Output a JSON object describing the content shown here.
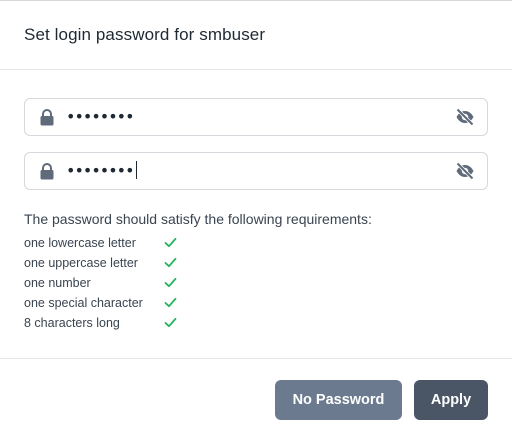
{
  "dialog": {
    "title": "Set login password for smbuser"
  },
  "fields": [
    {
      "name": "password",
      "value": "••••••••",
      "icon": "lock-icon",
      "toggle_icon": "eye-slash-icon"
    },
    {
      "name": "confirm_password",
      "value": "••••••••",
      "icon": "lock-icon",
      "toggle_icon": "eye-slash-icon"
    }
  ],
  "requirements": {
    "title": "The password should satisfy the following requirements:",
    "items": [
      {
        "label": "one lowercase letter",
        "satisfied": true
      },
      {
        "label": "one uppercase letter",
        "satisfied": true
      },
      {
        "label": "one number",
        "satisfied": true
      },
      {
        "label": "one special character",
        "satisfied": true
      },
      {
        "label": "8 characters long",
        "satisfied": true
      }
    ],
    "check_color": "#22b35e"
  },
  "buttons": {
    "no_password": "No Password",
    "apply": "Apply"
  }
}
